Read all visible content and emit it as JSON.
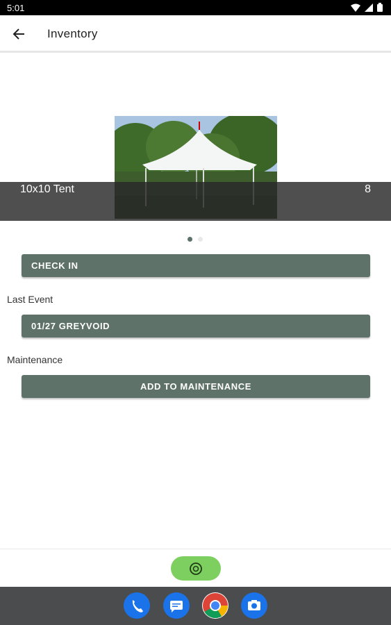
{
  "status_bar": {
    "time": "5:01"
  },
  "app_bar": {
    "title": "Inventory",
    "back_icon": "arrow-back-icon"
  },
  "carousel": {
    "item_name": "10x10 Tent",
    "item_count": "8",
    "image_description": "white tent photo",
    "page_count": 2,
    "active_page": 1
  },
  "actions": {
    "check_in_label": "CHECK IN",
    "last_event_heading": "Last Event",
    "last_event_value": "01/27 GREYVOID",
    "maintenance_heading": "Maintenance",
    "add_maintenance_label": "ADD TO MAINTENANCE"
  },
  "fab": {
    "icon": "scan-icon"
  },
  "dock": {
    "apps": [
      "phone-icon",
      "messages-icon",
      "chrome-icon",
      "camera-icon"
    ]
  },
  "colors": {
    "accent": "#5e7269",
    "fab": "#7dcf5f",
    "dock": "#4b4c4e"
  }
}
